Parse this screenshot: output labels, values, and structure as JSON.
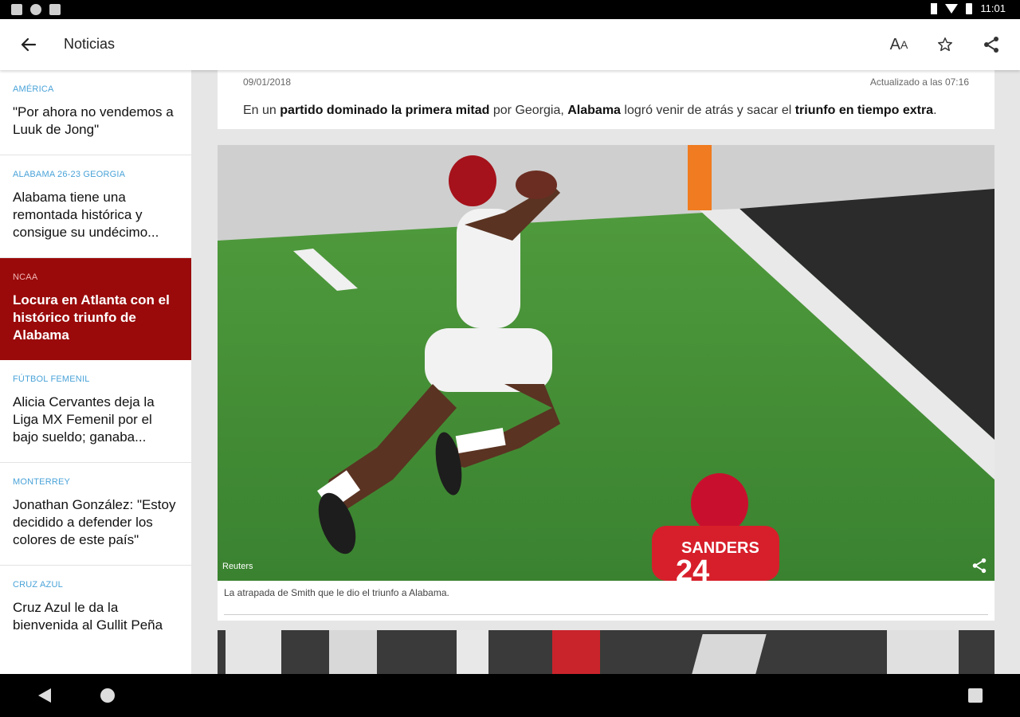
{
  "status_bar": {
    "time": "11:01"
  },
  "app_bar": {
    "title": "Noticias",
    "font_button": {
      "big": "A",
      "small": "A"
    }
  },
  "sidebar": {
    "items": [
      {
        "category": "AMÉRICA",
        "headline": "\"Por ahora no vendemos a Luuk de Jong\""
      },
      {
        "category": "ALABAMA 26-23 GEORGIA",
        "headline": "Alabama tiene una remontada histórica y consigue su undécimo..."
      },
      {
        "category": "NCAA",
        "headline": "Locura en Atlanta con el histórico triunfo de Alabama"
      },
      {
        "category": "FÚTBOL FEMENIL",
        "headline": "Alicia Cervantes deja la Liga MX Femenil por el bajo sueldo; ganaba..."
      },
      {
        "category": "MONTERREY",
        "headline": "Jonathan González: \"Estoy decidido a defender los colores de este país\""
      },
      {
        "category": "CRUZ AZUL",
        "headline": "Cruz Azul le da la bienvenida al Gullit Peña"
      }
    ]
  },
  "article": {
    "date": "09/01/2018",
    "updated": "Actualizado a las 07:16",
    "summary": {
      "p1": "En un ",
      "b1": "partido dominado la primera mitad",
      "p2": " por Georgia, ",
      "b2": "Alabama",
      "p3": " logró venir de atrás y sacar el ",
      "b3": "triunfo en tiempo extra",
      "p4": "."
    },
    "photo": {
      "source": "Reuters",
      "caption": "La atrapada de Smith que le dio el triunfo a Alabama.",
      "jersey_name": "SANDERS",
      "jersey_number": "24"
    }
  },
  "colors": {
    "accent": "#9a0a0a",
    "category": "#4aa3d8",
    "field": "#3f8a33"
  }
}
